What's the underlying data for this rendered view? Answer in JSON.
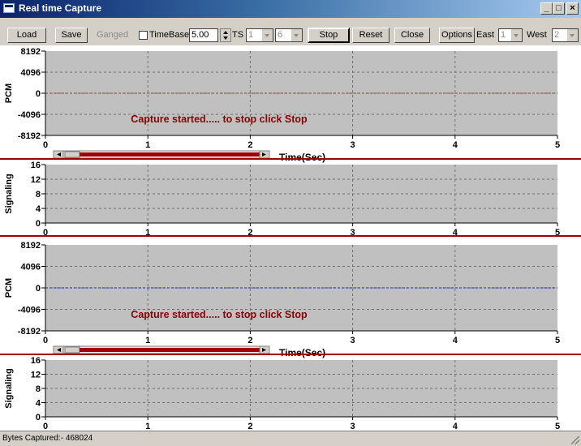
{
  "window": {
    "title": "Real time Capture"
  },
  "toolbar": {
    "load": "Load",
    "save": "Save",
    "ganged": "Ganged",
    "timebase_label": "TimeBase",
    "timebase_value": "5.00",
    "ts_label": "TS",
    "ts_value1": "1",
    "ts_value2": "6",
    "stop": "Stop",
    "reset": "Reset",
    "close": "Close",
    "options": "Options",
    "east_label": "East",
    "east_value": "1",
    "west_label": "West",
    "west_value": "2"
  },
  "colors": {
    "plot_bg": "#c0c0c0",
    "separator": "#a00000",
    "message": "#8b0000",
    "pcm_line_1": "#b03030",
    "pcm_line_2": "#1a2aa8",
    "scrollbar_thumb": "#a00000"
  },
  "chart_data": [
    {
      "type": "line",
      "ylabel": "PCM",
      "yticks": [
        "8192",
        "4096",
        "0",
        "-4096",
        "-8192"
      ],
      "ylim": [
        -8192,
        8192
      ],
      "xticks": [
        "0",
        "1",
        "2",
        "3",
        "4",
        "5"
      ],
      "xlim": [
        0,
        5
      ],
      "xlabel": "Time(Sec)",
      "grid": true,
      "message": "Capture started..... to stop click Stop",
      "series": [
        {
          "x": [
            0,
            5
          ],
          "values": [
            0,
            0
          ]
        }
      ]
    },
    {
      "type": "line",
      "ylabel": "Signaling",
      "yticks": [
        "16",
        "12",
        "8",
        "4",
        "0"
      ],
      "ylim": [
        0,
        16
      ],
      "xticks": [
        "0",
        "1",
        "2",
        "3",
        "4",
        "5"
      ],
      "xlim": [
        0,
        5
      ],
      "grid": true
    },
    {
      "type": "line",
      "ylabel": "PCM",
      "yticks": [
        "8192",
        "4096",
        "0",
        "-4096",
        "-8192"
      ],
      "ylim": [
        -8192,
        8192
      ],
      "xticks": [
        "0",
        "1",
        "2",
        "3",
        "4",
        "5"
      ],
      "xlim": [
        0,
        5
      ],
      "xlabel": "Time(Sec)",
      "grid": true,
      "message": "Capture started..... to stop click Stop",
      "series": [
        {
          "x": [
            0,
            5
          ],
          "values": [
            0,
            0
          ]
        }
      ]
    },
    {
      "type": "line",
      "ylabel": "Signaling",
      "yticks": [
        "16",
        "12",
        "8",
        "4",
        "0"
      ],
      "ylim": [
        0,
        16
      ],
      "xticks": [
        "0",
        "1",
        "2",
        "3",
        "4",
        "5"
      ],
      "xlim": [
        0,
        5
      ],
      "grid": true
    }
  ],
  "status": {
    "text": "Bytes Captured:- 468024"
  }
}
